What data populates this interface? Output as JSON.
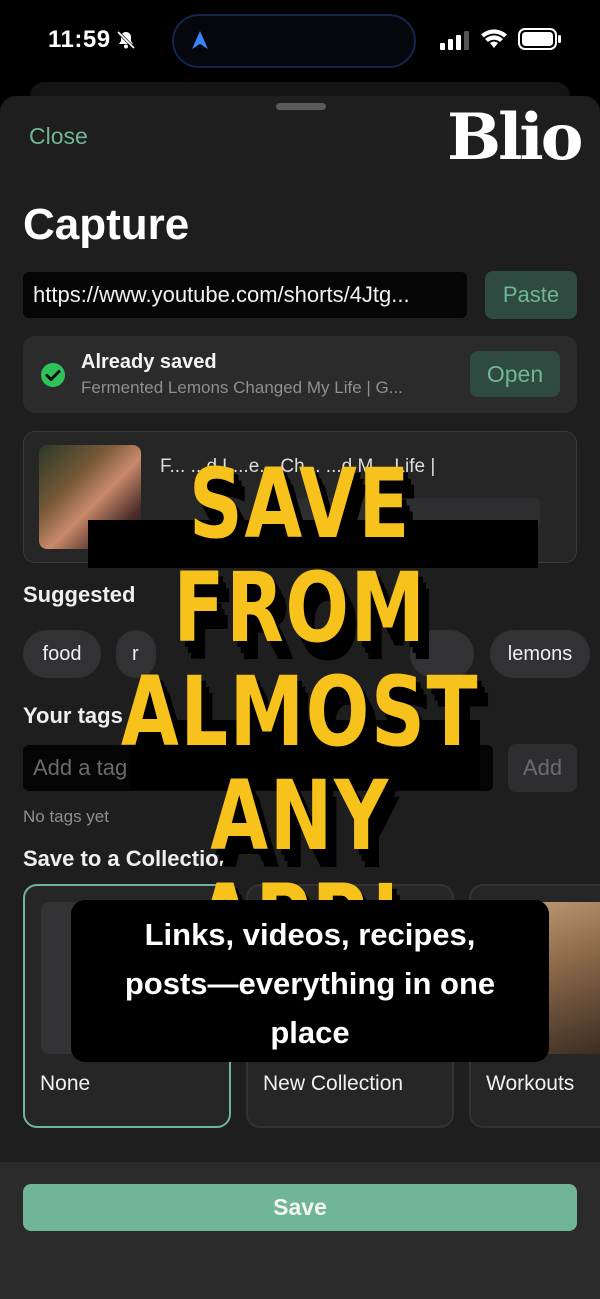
{
  "status_bar": {
    "time": "11:59"
  },
  "header": {
    "close_label": "Close",
    "logo_text": "Blio"
  },
  "page": {
    "title": "Capture"
  },
  "url_field": {
    "value": "https://www.youtube.com/shorts/4Jtg...",
    "paste_label": "Paste"
  },
  "saved_notice": {
    "title": "Already saved",
    "subtitle": "Fermented Lemons Changed My Life | G...",
    "open_label": "Open"
  },
  "preview": {
    "title_fragment": "F... ...d L...e... Ch... ...d M... Life |"
  },
  "suggested": {
    "label": "Suggested",
    "chips": [
      "food",
      "r",
      "lemons"
    ]
  },
  "your_tags": {
    "label": "Your tags",
    "placeholder": "Add a tag",
    "add_label": "Add",
    "empty_text": "No tags yet"
  },
  "collections": {
    "label": "Save to a Collection",
    "items": [
      {
        "name": "None",
        "selected": true
      },
      {
        "name": "New Collection",
        "selected": false
      },
      {
        "name": "Workouts",
        "selected": false
      }
    ]
  },
  "footer": {
    "save_label": "Save"
  },
  "promo": {
    "headline_lines": [
      "SAVE FROM",
      "ALMOST",
      "ANY APP!"
    ],
    "caption": "Links, videos, recipes, posts—everything in one place"
  },
  "colors": {
    "accent": "#6fb596",
    "promo_yellow": "#f7c21b",
    "background": "#1e1e1f"
  }
}
